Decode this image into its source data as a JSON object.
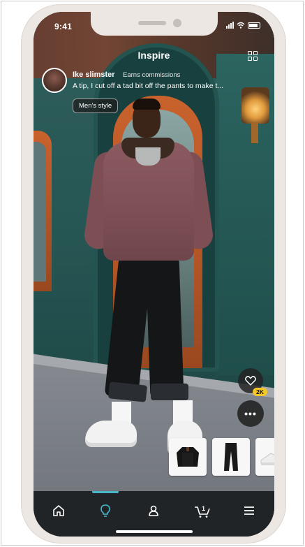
{
  "status_bar": {
    "time": "9:41"
  },
  "header": {
    "title": "Inspire"
  },
  "post": {
    "creator_name": "Ike slimster",
    "creator_tag": "Earns commissions",
    "caption": "A tip, I cut off a tad bit off the pants to make t...",
    "category_chip": "Men's style",
    "like_count": "2K"
  },
  "products": [
    {
      "icon": "jacket-thumbnail"
    },
    {
      "icon": "pants-thumbnail"
    },
    {
      "icon": "sneaker-thumbnail"
    }
  ],
  "tabbar": {
    "active_tab": "inspire",
    "cart_count": "1",
    "tabs": [
      "home-icon",
      "inspire-bulb-icon",
      "account-icon",
      "cart-icon",
      "menu-icon"
    ]
  },
  "colors": {
    "accent": "#47b6c8",
    "badge": "#f4c628",
    "tabbar_bg": "#202426"
  }
}
